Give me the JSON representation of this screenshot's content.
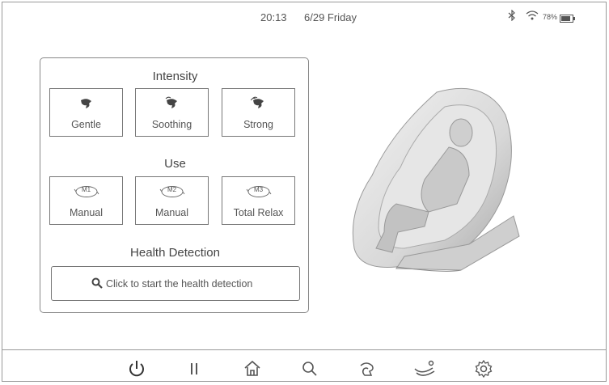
{
  "status": {
    "time": "20:13",
    "date": "6/29 Friday",
    "battery_percent": "78%"
  },
  "intensity": {
    "title": "Intensity",
    "buttons": [
      {
        "label": "Gentle",
        "icon": "gentle-icon"
      },
      {
        "label": "Soothing",
        "icon": "soothing-icon"
      },
      {
        "label": "Strong",
        "icon": "strong-icon"
      }
    ]
  },
  "use": {
    "title": "Use",
    "buttons": [
      {
        "badge": "M1",
        "label": "Manual"
      },
      {
        "badge": "M2",
        "label": "Manual"
      },
      {
        "badge": "M3",
        "label": "Total Relax"
      }
    ]
  },
  "health": {
    "title": "Health Detection",
    "button_label": "Click to start the health detection"
  },
  "nav": [
    "power-icon",
    "pause-icon",
    "home-icon",
    "search-icon",
    "massage-icon",
    "recline-icon",
    "settings-icon"
  ],
  "colors": {
    "border": "#777777",
    "text": "#444444",
    "background": "#ffffff"
  }
}
